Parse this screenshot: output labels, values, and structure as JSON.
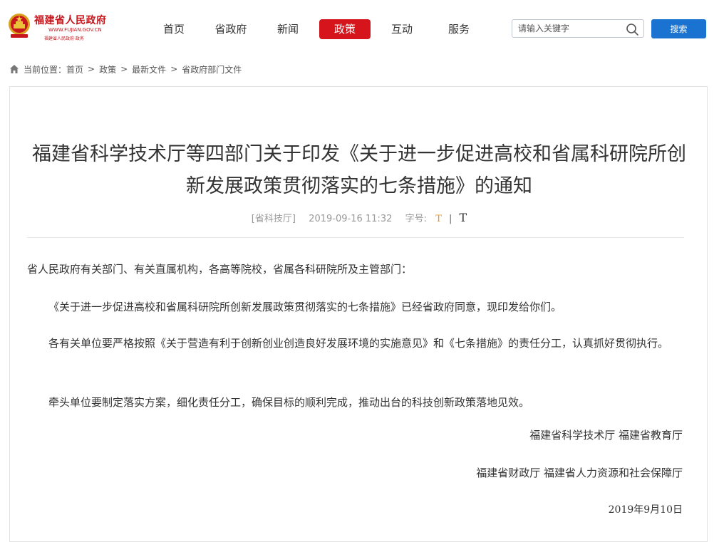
{
  "site": {
    "logo_title": "福建省人民政府",
    "logo_url": "WWW.FUJIAN.GOV.CN",
    "logo_subtitle": "福建省人民政府·政务"
  },
  "nav": {
    "items": [
      "首页",
      "省政府",
      "新闻",
      "政策",
      "互动",
      "服务"
    ],
    "active": "政策"
  },
  "search": {
    "placeholder": "请输入关键字",
    "button_label": "搜索"
  },
  "breadcrumb": {
    "label": "当前位置：",
    "items": [
      "首页",
      "政策",
      "最新文件",
      "省政府部门文件"
    ],
    "separator": ">"
  },
  "article": {
    "title": "福建省科学技术厅等四部门关于印发《关于进一步促进高校和省属科研院所创新发展政策贯彻落实的七条措施》的通知",
    "source": "[省科技厅]",
    "date": "2019-09-16 11:32",
    "font_size_label": "字号:",
    "font_small": "T",
    "font_divider": "|",
    "font_large": "T",
    "paragraphs": [
      "省人民政府有关部门、有关直属机构，各高等院校，省属各科研院所及主管部门：",
      "《关于进一步促进高校和省属科研院所创新发展政策贯彻落实的七条措施》已经省政府同意，现印发给你们。",
      "各有关单位要严格按照《关于营造有利于创新创业创造良好发展环境的实施意见》和《七条措施》的责任分工，认真抓好贯彻执行。",
      "牵头单位要制定落实方案，细化责任分工，确保目标的顺利完成，推动出台的科技创新政策落地见效。"
    ],
    "signatures": [
      "福建省科学技术厅  福建省教育厅",
      "福建省财政厅  福建省人力资源和社会保障厅"
    ],
    "sign_date": "2019年9月10日"
  },
  "colors": {
    "brand_red": "#d6141b",
    "search_blue": "#1a73d0"
  }
}
